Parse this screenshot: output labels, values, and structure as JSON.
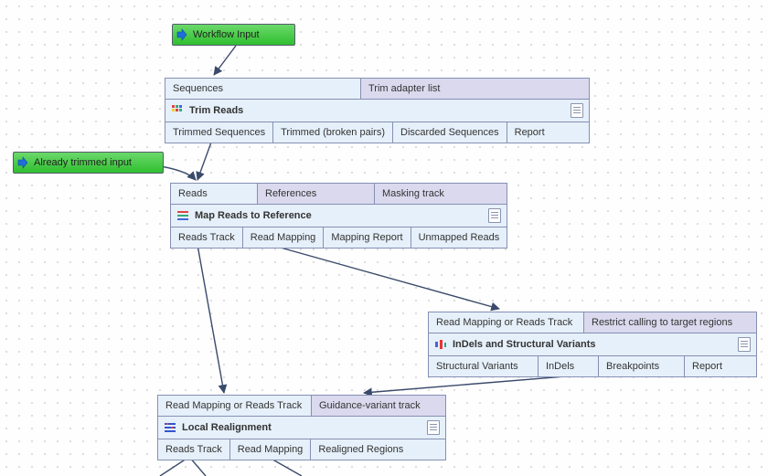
{
  "inputs": {
    "workflow_input": "Workflow Input",
    "already_trimmed": "Already trimmed input"
  },
  "trim": {
    "title": "Trim Reads",
    "in": {
      "sequences": "Sequences",
      "adapter_list": "Trim adapter list"
    },
    "out": {
      "trimmed": "Trimmed Sequences",
      "broken": "Trimmed (broken pairs)",
      "discarded": "Discarded Sequences",
      "report": "Report"
    }
  },
  "map": {
    "title": "Map Reads to Reference",
    "in": {
      "reads": "Reads",
      "refs": "References",
      "mask": "Masking track"
    },
    "out": {
      "reads_track": "Reads Track",
      "mapping": "Read Mapping",
      "report": "Mapping Report",
      "unmapped": "Unmapped Reads"
    }
  },
  "indels": {
    "title": "InDels and Structural Variants",
    "in": {
      "mapping": "Read Mapping or Reads Track",
      "restrict": "Restrict calling to target regions"
    },
    "out": {
      "sv": "Structural Variants",
      "indels": "InDels",
      "bp": "Breakpoints",
      "report": "Report"
    }
  },
  "realign": {
    "title": "Local Realignment",
    "in": {
      "mapping": "Read Mapping or Reads Track",
      "guidance": "Guidance-variant track"
    },
    "out": {
      "reads_track": "Reads Track",
      "mapping": "Read Mapping",
      "regions": "Realigned Regions"
    }
  }
}
